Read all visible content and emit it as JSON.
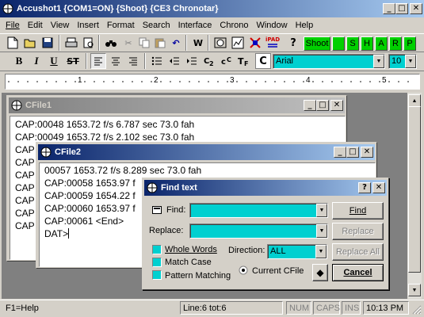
{
  "app": {
    "title": "Accushot1 {COM1=ON} {Shoot}  {CE3 Chronotar}",
    "controls": {
      "minimize": "_",
      "maximize": "□",
      "close": "✕"
    }
  },
  "menu": [
    "File",
    "Edit",
    "View",
    "Insert",
    "Format",
    "Search",
    "Interface",
    "Chrono",
    "Window",
    "Help"
  ],
  "toolbar1": {
    "ipad_label": "iPAD",
    "shoot_label": "Shoot",
    "green_letters": [
      "S",
      "H",
      "A",
      "R",
      "P"
    ]
  },
  "toolbar2": {
    "bold": "B",
    "italic": "I",
    "underline": "U",
    "strike": "ST",
    "c_button": "C",
    "font_value": "Arial",
    "size_value": "10"
  },
  "ruler": {
    "numbers": [
      "1",
      "2",
      "3",
      "4",
      "5"
    ]
  },
  "cfile1": {
    "title": "CFile1",
    "lines": [
      "CAP:00048 1653.72 f/s 6.787 sec 73.0 fah",
      "CAP:00049 1653.72 f/s 2.102 sec 73.0 fah",
      "CAP",
      "CAP",
      "CAP",
      "CAP",
      "CAP",
      "CAP",
      "CAP"
    ]
  },
  "cfile2": {
    "title": "CFile2",
    "lines": [
      "00057 1653.72 f/s 8.289 sec 73.0 fah",
      "CAP:00058 1653.97 f",
      "CAP:00059 1654.22 f",
      "CAP:00060 1653.97 f",
      "CAP:00061 <End>",
      "DAT>"
    ]
  },
  "find_dialog": {
    "title": "Find text",
    "help": "?",
    "close": "✕",
    "find_label": "Find:",
    "replace_label": "Replace:",
    "find_button": "Find",
    "replace_button": "Replace",
    "replace_all_button": "Replace All",
    "cancel_button": "Cancel",
    "whole_words": "Whole Words",
    "match_case": "Match Case",
    "pattern_matching": "Pattern Matching",
    "direction_label": "Direction:",
    "direction_value": "ALL",
    "current_cfile": "Current CFile"
  },
  "status": {
    "help": "F1=Help",
    "position": "Line:6 tot:6",
    "num": "NUM",
    "caps": "CAPS",
    "ins": "INS",
    "time": "10:13 PM"
  }
}
